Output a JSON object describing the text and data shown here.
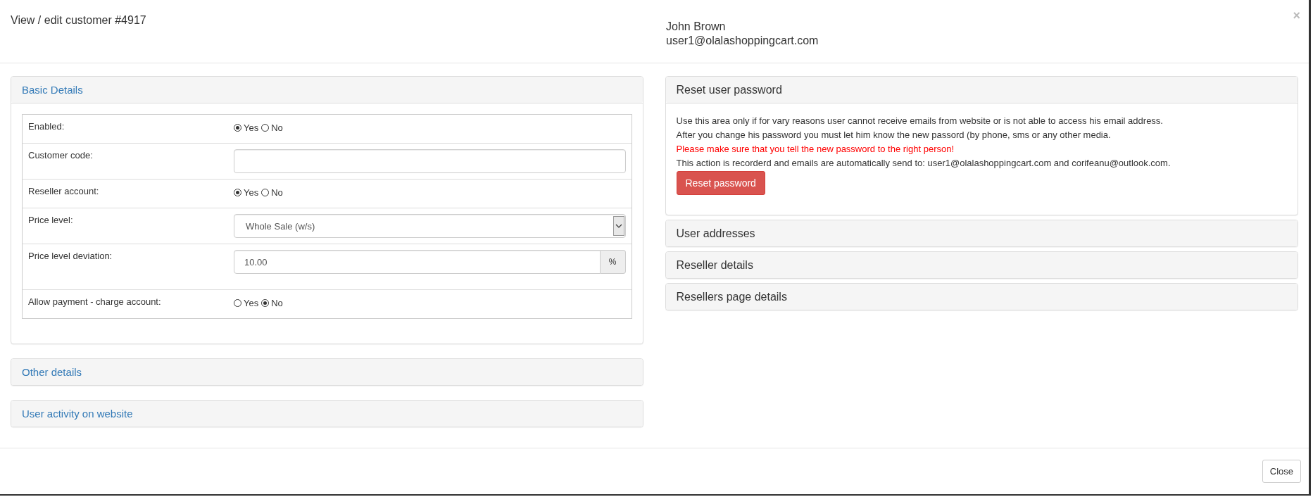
{
  "dialog": {
    "title": "View / edit customer #4917",
    "customer_name": "John Brown",
    "customer_email": "user1@olalashoppingcart.com",
    "close_glyph": "×"
  },
  "left_panels": [
    {
      "title": "Basic Details",
      "expanded": true,
      "fields": [
        {
          "kind": "radio",
          "label": "Enabled:",
          "options": [
            {
              "label": "Yes",
              "selected": true
            },
            {
              "label": "No",
              "selected": false
            }
          ]
        },
        {
          "kind": "text",
          "label": "Customer code:"
        },
        {
          "kind": "radio",
          "label": "Reseller account:",
          "options": [
            {
              "label": "Yes",
              "selected": true
            },
            {
              "label": "No",
              "selected": false
            }
          ]
        },
        {
          "kind": "select",
          "label": "Price level:",
          "value": "Whole Sale (w/s)"
        },
        {
          "kind": "addon",
          "label": "Price level deviation:",
          "value": "10.00",
          "addon": "%"
        },
        {
          "kind": "radio",
          "label": "Allow payment - charge account:",
          "options": [
            {
              "label": "Yes",
              "selected": false
            },
            {
              "label": "No",
              "selected": true
            }
          ]
        }
      ]
    },
    {
      "title": "Other details",
      "expanded": false
    },
    {
      "title": "User activity on website",
      "expanded": false
    }
  ],
  "right_panels": [
    {
      "title": "Reset user password",
      "expanded": true,
      "lines": [
        {
          "kind": "normal",
          "text": "Use this area only if for vary reasons user cannot receive emails from website or is not able to access his email address."
        },
        {
          "kind": "normal",
          "text": "After you change his password you must let him know the new passord (by phone, sms or any other media."
        },
        {
          "kind": "warning",
          "text": "Please make sure that you tell the new password to the right person!"
        },
        {
          "kind": "normal",
          "text": "This action is recorderd and emails are automatically send to: user1@olalashoppingcart.com and corifeanu@outlook.com."
        }
      ],
      "button": "Reset password"
    },
    {
      "title": "User addresses",
      "expanded": false
    },
    {
      "title": "Reseller details",
      "expanded": false
    },
    {
      "title": "Resellers page details",
      "expanded": false
    }
  ],
  "footer": {
    "button": "Close"
  }
}
